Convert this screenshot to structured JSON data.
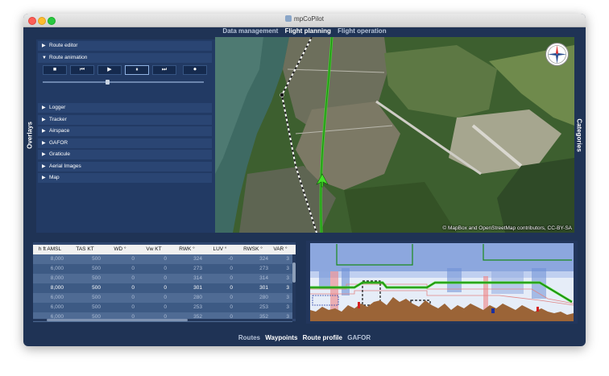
{
  "window": {
    "title": "mpCoPilot"
  },
  "mode_tabs": [
    {
      "label": "Data management",
      "active": false
    },
    {
      "label": "Flight planning",
      "active": true
    },
    {
      "label": "Flight operation",
      "active": false
    }
  ],
  "side_labels": {
    "left": "Overlays",
    "right": "Categories"
  },
  "overlays": {
    "route_editor": "Route editor",
    "route_animation": "Route animation",
    "items": [
      "Logger",
      "Tracker",
      "Airspace",
      "GAFOR",
      "Graticule",
      "Aerial Images",
      "Map"
    ],
    "animation_buttons": [
      {
        "icon": "stop-icon",
        "glyph": "■"
      },
      {
        "icon": "rewind-icon",
        "glyph": "⏮"
      },
      {
        "icon": "play-icon",
        "glyph": "▶"
      },
      {
        "icon": "pause-icon",
        "glyph": "⏸"
      },
      {
        "icon": "fast-forward-icon",
        "glyph": "⏭"
      },
      {
        "icon": "record-icon",
        "glyph": "⏺"
      }
    ],
    "animation_progress": 0.4
  },
  "map": {
    "attribution": "© MapBox and OpenStreetMap contributors, CC-BY-SA"
  },
  "waypoints_table": {
    "columns": [
      "h ft AMSL",
      "TAS KT",
      "WD °",
      "Vw KT",
      "RWK °",
      "LUV °",
      "RWSK °",
      "VAR °"
    ],
    "rows": [
      [
        "8,000",
        "500",
        "0",
        "0",
        "324",
        "-0",
        "324",
        "3"
      ],
      [
        "6,000",
        "500",
        "0",
        "0",
        "273",
        "0",
        "273",
        "3"
      ],
      [
        "8,000",
        "500",
        "0",
        "0",
        "314",
        "0",
        "314",
        "3"
      ],
      [
        "8,000",
        "500",
        "0",
        "0",
        "301",
        "0",
        "301",
        "3"
      ],
      [
        "6,000",
        "500",
        "0",
        "0",
        "280",
        "0",
        "280",
        "3"
      ],
      [
        "6,000",
        "500",
        "0",
        "0",
        "253",
        "0",
        "253",
        "3"
      ],
      [
        "6,000",
        "500",
        "0",
        "0",
        "352",
        "0",
        "352",
        "3"
      ]
    ]
  },
  "bottom_tabs": [
    {
      "label": "Routes",
      "active": false
    },
    {
      "label": "Waypoints",
      "active": true
    },
    {
      "label": "Route profile",
      "active": true
    },
    {
      "label": "GAFOR",
      "active": false
    }
  ],
  "colors": {
    "background": "#1f3355",
    "panel": "#223a64",
    "route_green": "#3fd12a",
    "terrain": "#9b6437"
  }
}
